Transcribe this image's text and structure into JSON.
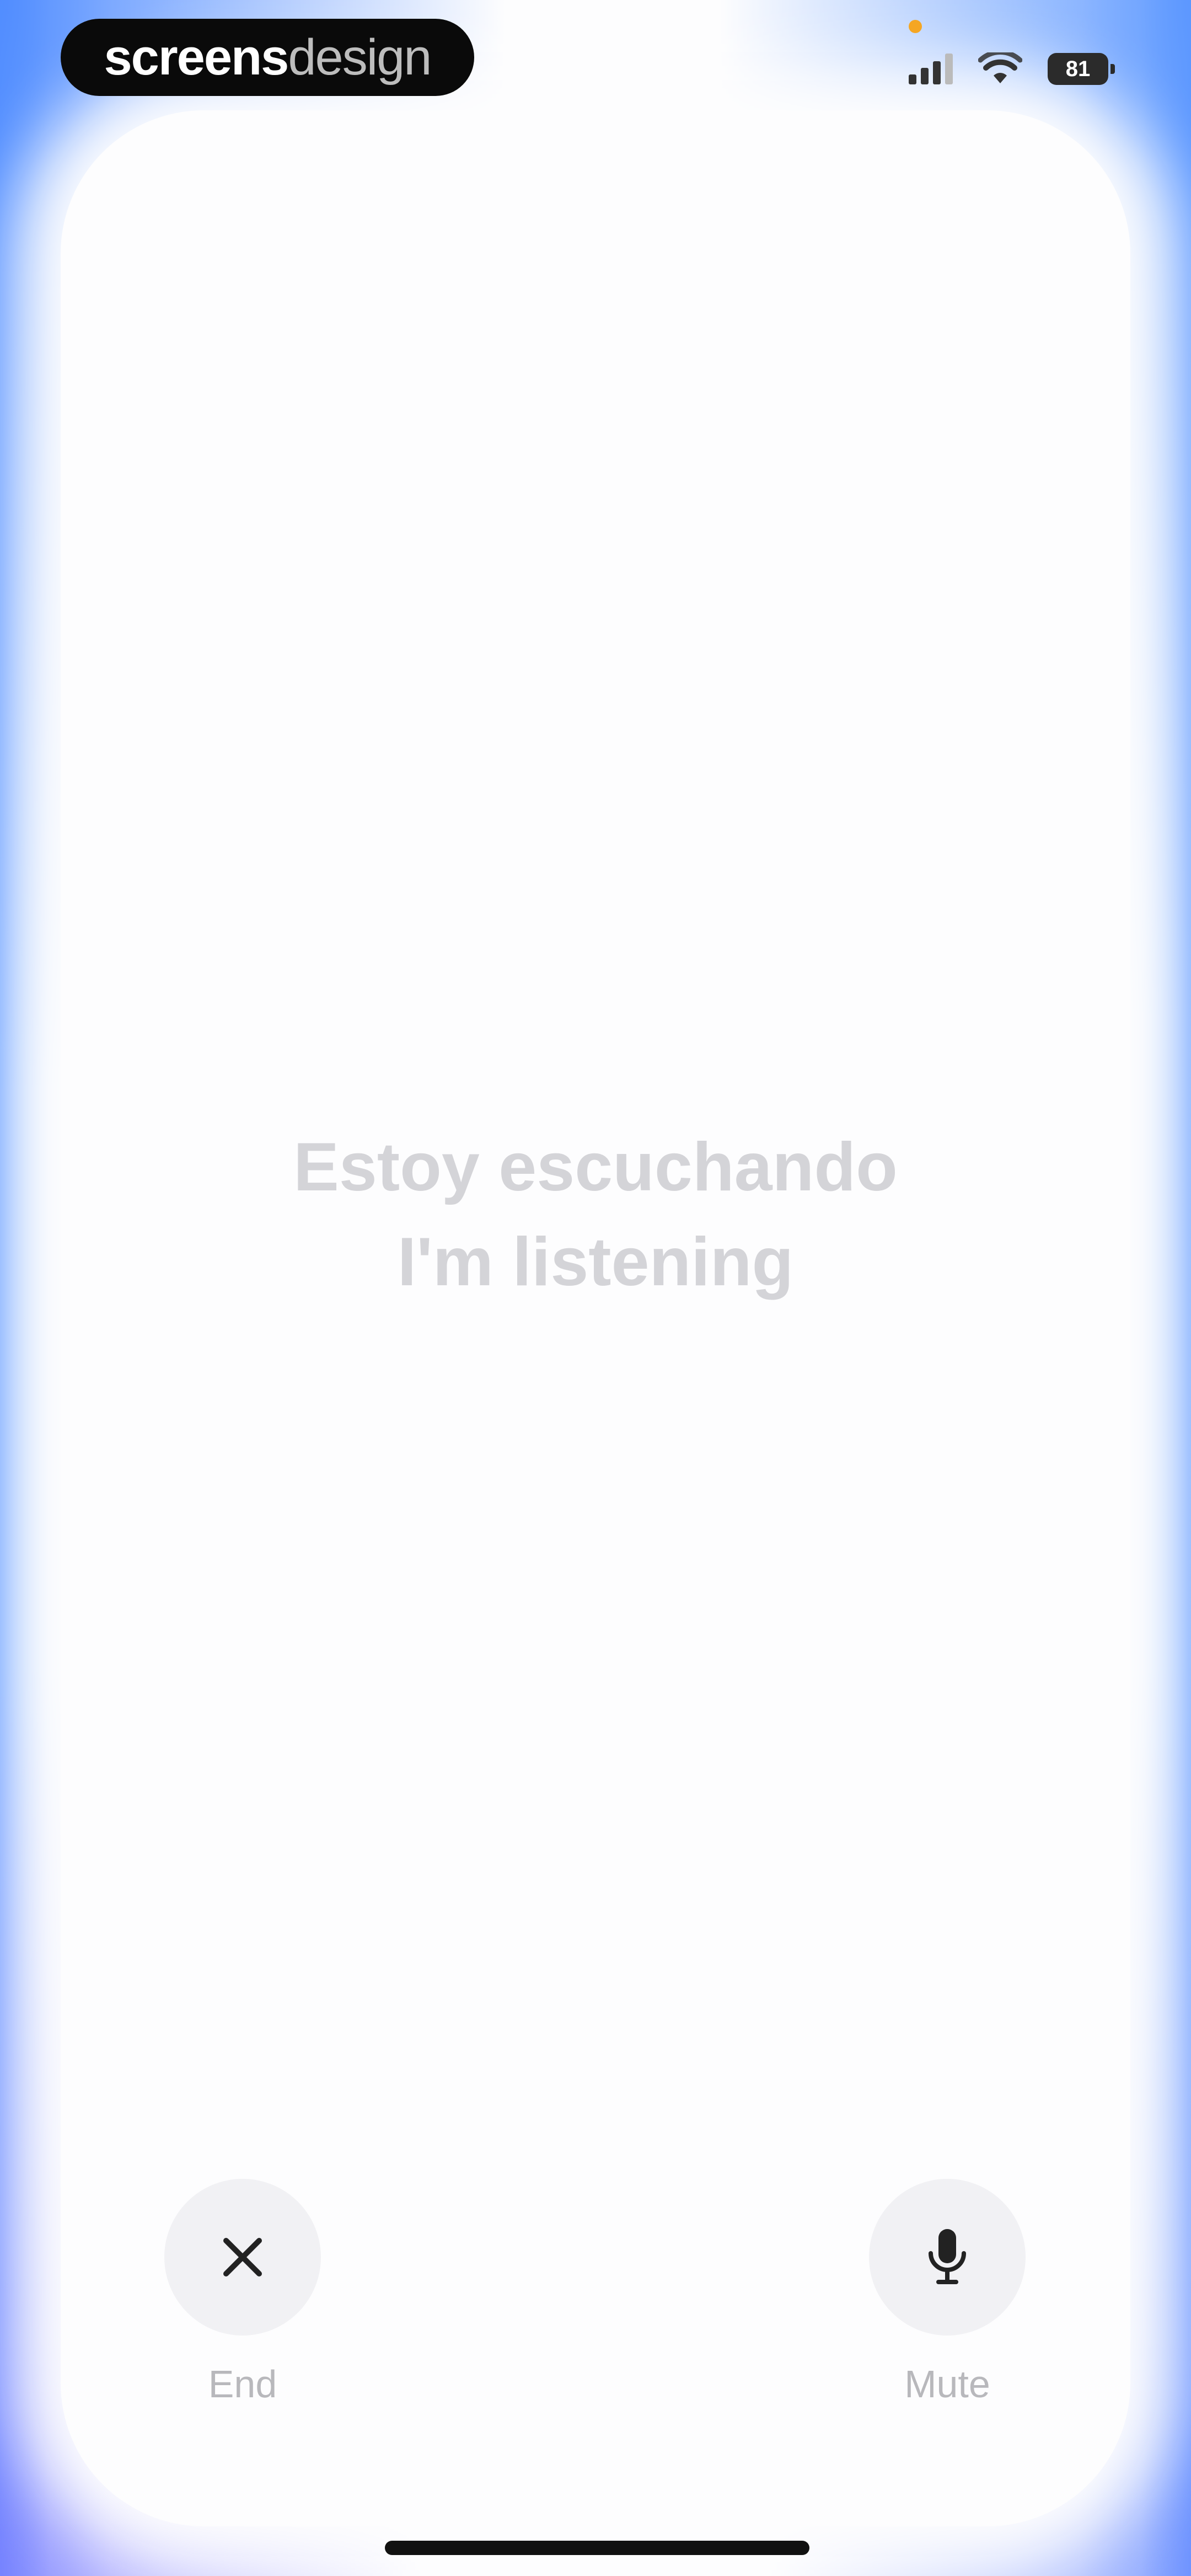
{
  "status_bar": {
    "brand_bold": "screens",
    "brand_light": "design",
    "battery": "81",
    "icons": [
      "signal-icon",
      "wifi-icon",
      "battery-icon"
    ]
  },
  "main": {
    "listening_es": "Estoy escuchando",
    "listening_en": "I'm listening"
  },
  "controls": {
    "end_label": "End",
    "end_icon": "close-icon",
    "mute_label": "Mute",
    "mute_icon": "microphone-icon"
  },
  "colors": {
    "edge_glow": "#508cff",
    "muted_text": "#d4d4d8",
    "control_bg": "#f1f1f4"
  }
}
